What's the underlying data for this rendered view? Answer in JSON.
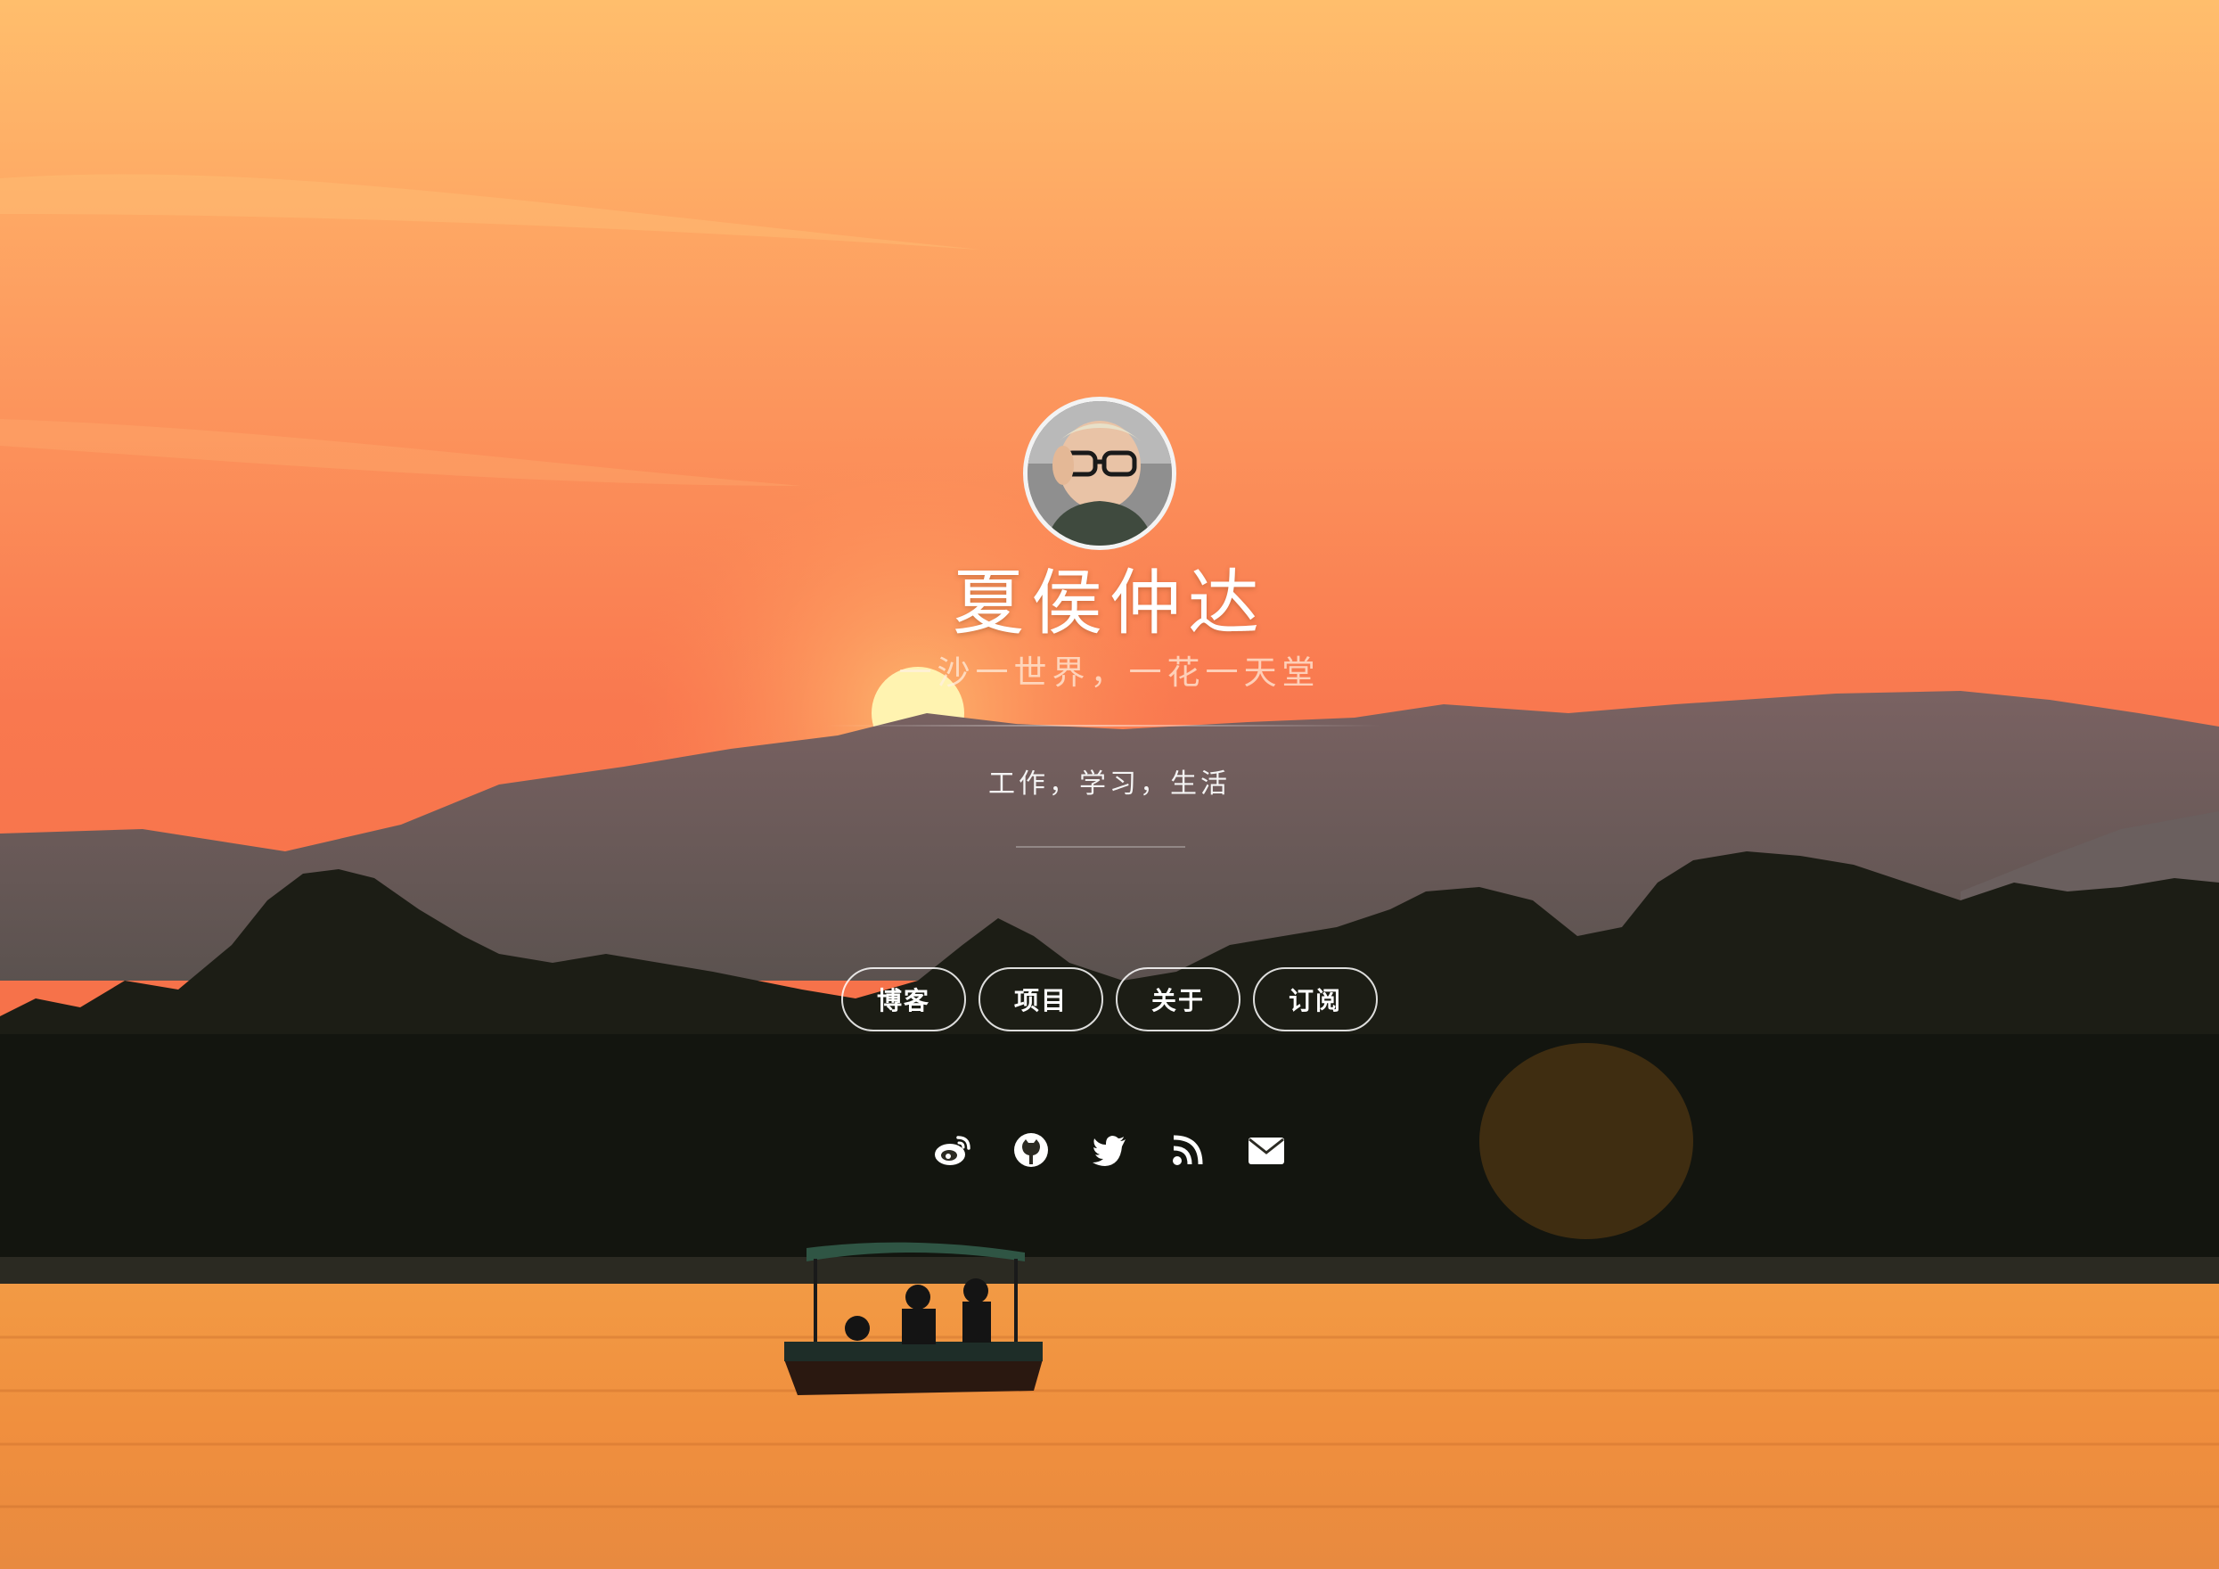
{
  "profile": {
    "name": "夏侯仲达",
    "motto": "一沙一世界，一花一天堂",
    "description": "工作，学习，生活"
  },
  "nav": {
    "items": [
      {
        "label": "博客"
      },
      {
        "label": "项目"
      },
      {
        "label": "关于"
      },
      {
        "label": "订阅"
      }
    ]
  },
  "social": {
    "icons": [
      "weibo-icon",
      "github-icon",
      "twitter-icon",
      "rss-icon",
      "email-icon"
    ]
  },
  "colors": {
    "sky_top": "#ffbd6a",
    "sky_mid": "#fb8f58",
    "mountain": "#6b5b5e",
    "forest": "#171a12",
    "water": "#f39844"
  }
}
